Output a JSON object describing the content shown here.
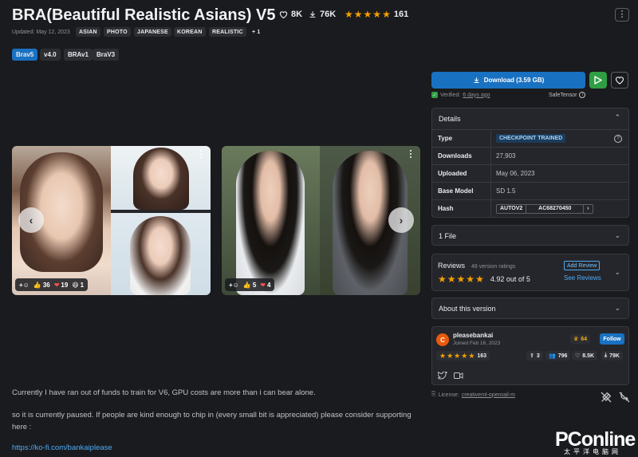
{
  "header": {
    "title": "BRA(Beautiful Realistic Asians) V5",
    "likes": "8K",
    "downloads": "76K",
    "rating_count": "161",
    "updated": "Updated: May 12, 2023",
    "tags": [
      "ASIAN",
      "PHOTO",
      "JAPANESE",
      "KOREAN",
      "REALISTIC"
    ],
    "more_tags": "+ 1"
  },
  "versions": [
    "Brav5",
    "v4.0",
    "BRAv1",
    "BraV3"
  ],
  "gallery": [
    {
      "thumbs_up": "36",
      "hearts": "19",
      "laughs": "1"
    },
    {
      "thumbs_up": "5",
      "hearts": "4"
    }
  ],
  "download": {
    "label": "Download (3.59 GB)",
    "verified_prefix": "Verified:",
    "verified_when": "6 days ago",
    "format": "SafeTensor"
  },
  "details": {
    "heading": "Details",
    "rows": [
      {
        "key": "Type",
        "value": "CHECKPOINT TRAINED"
      },
      {
        "key": "Downloads",
        "value": "27,903"
      },
      {
        "key": "Uploaded",
        "value": "May 06, 2023"
      },
      {
        "key": "Base Model",
        "value": "SD 1.5"
      },
      {
        "key": "Hash",
        "value_a": "AUTOV2",
        "value_b": "AC68270450"
      }
    ]
  },
  "files": {
    "heading": "1 File"
  },
  "reviews": {
    "heading": "Reviews",
    "count": "48 version ratings",
    "score": "4.92 out of 5",
    "add_label": "Add Review",
    "see_label": "See Reviews"
  },
  "about": {
    "heading": "About this version"
  },
  "creator": {
    "initial": "C",
    "name": "pleasebankai",
    "joined": "Joined Feb 16, 2023",
    "level": "64",
    "follow_label": "Follow",
    "rating_count": "163",
    "uploads": "3",
    "followers": "796",
    "likes": "8.5K",
    "downloads": "79K"
  },
  "license": {
    "prefix": "License:",
    "name": "creativeml-openrail-m"
  },
  "description": {
    "line1": "Currently I have ran out of funds to train for V6, GPU costs are more than i can bear alone.",
    "line2": "so it is currently paused. If people are kind enough to chip in (every small bit is appreciated) please consider supporting",
    "line3": "here :",
    "link": "https://ko-fi.com/bankaiplease"
  },
  "watermark": {
    "brand": "PConline",
    "sub": "太平洋电脑网"
  },
  "colors": {
    "accent": "#1971c2",
    "play": "#2f9e44",
    "star": "#f59f00",
    "background": "#1a1b1e",
    "panel": "#25262b"
  }
}
